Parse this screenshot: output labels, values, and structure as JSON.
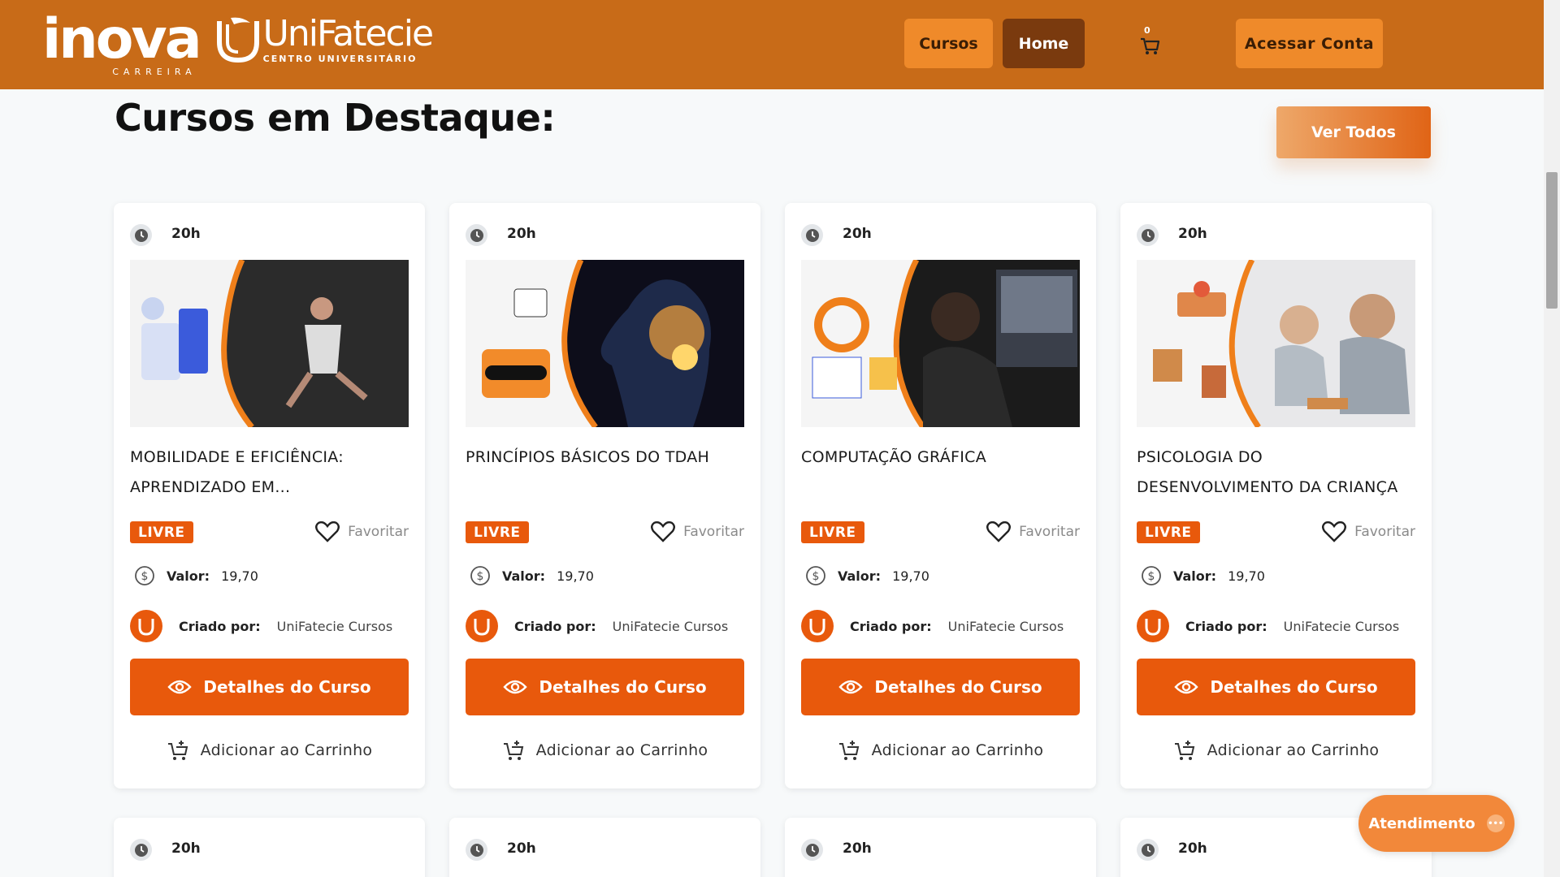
{
  "header": {
    "logo_primary": "inova",
    "logo_primary_sub": "CARREIRA",
    "logo_secondary": "UniFatecie",
    "logo_secondary_sub": "CENTRO UNIVERSITÁRIO",
    "nav_cursos": "Cursos",
    "nav_home": "Home",
    "cart_count": "0",
    "account": "Acessar Conta"
  },
  "section": {
    "title": "Cursos em Destaque:",
    "ver_todos": "Ver Todos"
  },
  "cards": [
    {
      "hours": "20h",
      "title": "MOBILIDADE E EFICIÊNCIA: APRENDIZADO EM...",
      "badge": "LIVRE",
      "favorite": "Favoritar",
      "valor_label": "Valor:",
      "valor": "19,70",
      "criado_label": "Criado por:",
      "criado_name": "UniFatecie Cursos",
      "details": "Detalhes do Curso",
      "add_cart": "Adicionar ao Carrinho"
    },
    {
      "hours": "20h",
      "title": "PRINCÍPIOS BÁSICOS DO TDAH",
      "badge": "LIVRE",
      "favorite": "Favoritar",
      "valor_label": "Valor:",
      "valor": "19,70",
      "criado_label": "Criado por:",
      "criado_name": "UniFatecie Cursos",
      "details": "Detalhes do Curso",
      "add_cart": "Adicionar ao Carrinho"
    },
    {
      "hours": "20h",
      "title": "COMPUTAÇÃO GRÁFICA",
      "badge": "LIVRE",
      "favorite": "Favoritar",
      "valor_label": "Valor:",
      "valor": "19,70",
      "criado_label": "Criado por:",
      "criado_name": "UniFatecie Cursos",
      "details": "Detalhes do Curso",
      "add_cart": "Adicionar ao Carrinho"
    },
    {
      "hours": "20h",
      "title": "PSICOLOGIA DO DESENVOLVIMENTO DA CRIANÇA",
      "badge": "LIVRE",
      "favorite": "Favoritar",
      "valor_label": "Valor:",
      "valor": "19,70",
      "criado_label": "Criado por:",
      "criado_name": "UniFatecie Cursos",
      "details": "Detalhes do Curso",
      "add_cart": "Adicionar ao Carrinho"
    }
  ],
  "next_row_hours": [
    "20h",
    "20h",
    "20h",
    "20h"
  ],
  "chat": {
    "label": "Atendimento"
  },
  "colors": {
    "header": "#c86b18",
    "accent": "#e8590c",
    "dark_nav": "#7a3a0e",
    "light_nav": "#ef8a2a"
  }
}
